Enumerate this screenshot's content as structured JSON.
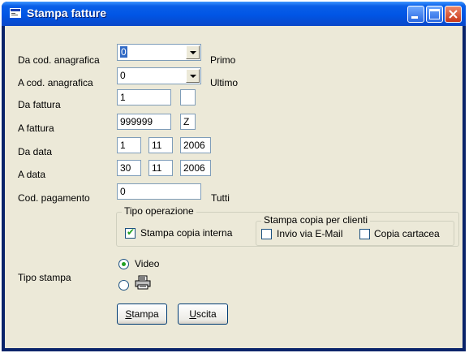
{
  "window": {
    "title": "Stampa fatture"
  },
  "fields": {
    "da_cod_anagrafica": {
      "label": "Da cod. anagrafica",
      "value": "0",
      "hint": "Primo"
    },
    "a_cod_anagrafica": {
      "label": "A cod. anagrafica",
      "value": "0",
      "hint": "Ultimo"
    },
    "da_fattura": {
      "label": "Da fattura",
      "value": "1",
      "suffix": ""
    },
    "a_fattura": {
      "label": "A fattura",
      "value": "999999",
      "suffix": "Z"
    },
    "da_data": {
      "label": "Da data",
      "day": "1",
      "month": "11",
      "year": "2006"
    },
    "a_data": {
      "label": "A data",
      "day": "30",
      "month": "11",
      "year": "2006"
    },
    "cod_pagamento": {
      "label": "Cod. pagamento",
      "value": "0",
      "hint": "Tutti"
    }
  },
  "tipo_operazione": {
    "label": "Tipo operazione",
    "stampa_copia_interna": {
      "label": "Stampa copia interna",
      "checked": true
    },
    "clienti_group": {
      "label": "Stampa copia per clienti",
      "invio_email": {
        "label": "Invio via E-Mail",
        "checked": false
      },
      "copia_cartacea": {
        "label": "Copia cartacea",
        "checked": false
      }
    }
  },
  "tipo_stampa": {
    "label": "Tipo stampa",
    "video": {
      "label": "Video",
      "selected": true
    },
    "printer": {
      "icon": "printer-icon",
      "selected": false
    }
  },
  "buttons": {
    "stampa": {
      "accel": "S",
      "rest": "tampa"
    },
    "uscita": {
      "accel": "U",
      "rest": "scita"
    }
  }
}
